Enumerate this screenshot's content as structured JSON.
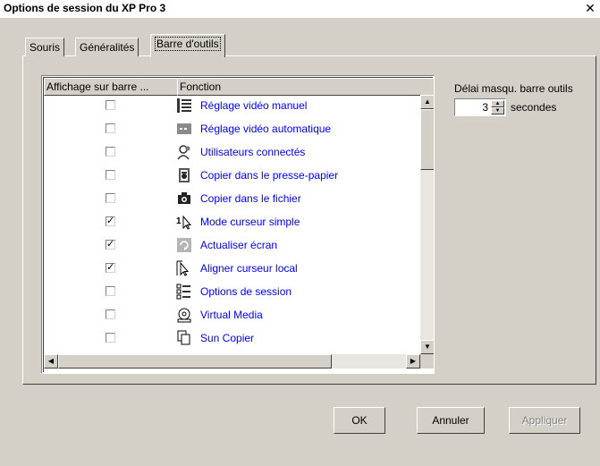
{
  "window": {
    "title": "Options de session du XP Pro 3",
    "close_glyph": "✕"
  },
  "tabs": [
    {
      "label": "Souris"
    },
    {
      "label": "Généralités"
    },
    {
      "label": "Barre d'outils",
      "selected": true
    }
  ],
  "table": {
    "columns": [
      "Affichage sur barre ...",
      "Fonction"
    ],
    "rows": [
      {
        "checked": false,
        "icon": "manual-video-icon",
        "label": "Réglage vidéo manuel"
      },
      {
        "checked": false,
        "icon": "auto-video-icon",
        "label": "Réglage vidéo automatique"
      },
      {
        "checked": false,
        "icon": "users-icon",
        "label": "Utilisateurs connectés"
      },
      {
        "checked": false,
        "icon": "camera-clipboard-icon",
        "label": "Copier dans le presse-papier"
      },
      {
        "checked": false,
        "icon": "camera-file-icon",
        "label": "Copier dans le fichier"
      },
      {
        "checked": true,
        "icon": "single-cursor-icon",
        "label": "Mode curseur simple"
      },
      {
        "checked": true,
        "icon": "refresh-icon",
        "label": "Actualiser écran"
      },
      {
        "checked": true,
        "icon": "align-cursor-icon",
        "label": "Aligner curseur local"
      },
      {
        "checked": false,
        "icon": "session-options-icon",
        "label": "Options de session"
      },
      {
        "checked": false,
        "icon": "virtual-media-icon",
        "label": "Virtual Media"
      },
      {
        "checked": false,
        "icon": "copy-icon",
        "label": "Sun Copier"
      }
    ]
  },
  "delay": {
    "label": "Délai masqu. barre outils",
    "value": "3",
    "unit": "secondes"
  },
  "buttons": {
    "ok": "OK",
    "cancel": "Annuler",
    "apply": "Appliquer"
  }
}
